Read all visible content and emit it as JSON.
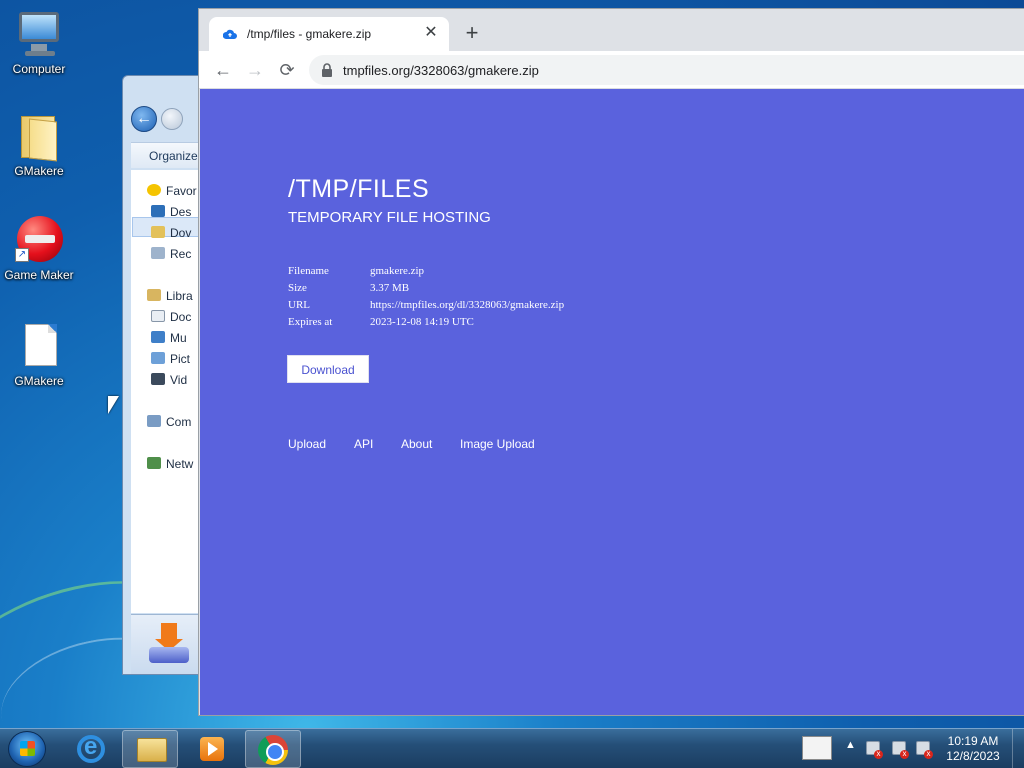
{
  "desktop": {
    "icons": [
      {
        "label": "Computer",
        "icon": "computer-icon"
      },
      {
        "label": "GMakere",
        "icon": "folder-icon"
      },
      {
        "label": "Game Maker",
        "icon": "game-maker-icon"
      },
      {
        "label": "GMakere",
        "icon": "file-icon"
      }
    ]
  },
  "explorer": {
    "toolbar_label": "Organize",
    "nav_items": [
      {
        "label": "Favor",
        "icon": "star-icon"
      },
      {
        "label": "Des",
        "icon": "desktop-icon"
      },
      {
        "label": "Dov",
        "icon": "downloads-icon"
      },
      {
        "label": "Rec",
        "icon": "recent-places-icon"
      },
      {
        "label": "Libra",
        "icon": "libraries-icon"
      },
      {
        "label": "Doc",
        "icon": "documents-icon"
      },
      {
        "label": "Mu",
        "icon": "music-icon"
      },
      {
        "label": "Pict",
        "icon": "pictures-icon"
      },
      {
        "label": "Vid",
        "icon": "videos-icon"
      },
      {
        "label": "Com",
        "icon": "computer-icon"
      },
      {
        "label": "Netw",
        "icon": "network-icon"
      }
    ]
  },
  "browser": {
    "tab_title": "/tmp/files - gmakere.zip",
    "tab_close": "✕",
    "new_tab": "+",
    "url": "tmpfiles.org/3328063/gmakere.zip",
    "nav": {
      "back": "←",
      "forward": "→",
      "reload": "⟳"
    }
  },
  "page": {
    "title": "/TMP/FILES",
    "subtitle": "TEMPORARY FILE HOSTING",
    "info": [
      {
        "key": "Filename",
        "value": "gmakere.zip"
      },
      {
        "key": "Size",
        "value": "3.37 MB"
      },
      {
        "key": "URL",
        "value": "https://tmpfiles.org/dl/3328063/gmakere.zip"
      },
      {
        "key": "Expires at",
        "value": "2023-12-08 14:19 UTC"
      }
    ],
    "download_label": "Download",
    "footer_links": [
      "Upload",
      "API",
      "About",
      "Image Upload"
    ]
  },
  "taskbar": {
    "time": "10:19 AM",
    "date": "12/8/2023",
    "tray_arrow": "▲"
  },
  "colors": {
    "page_background": "#5a62dd",
    "download_text": "#4a52d0"
  }
}
